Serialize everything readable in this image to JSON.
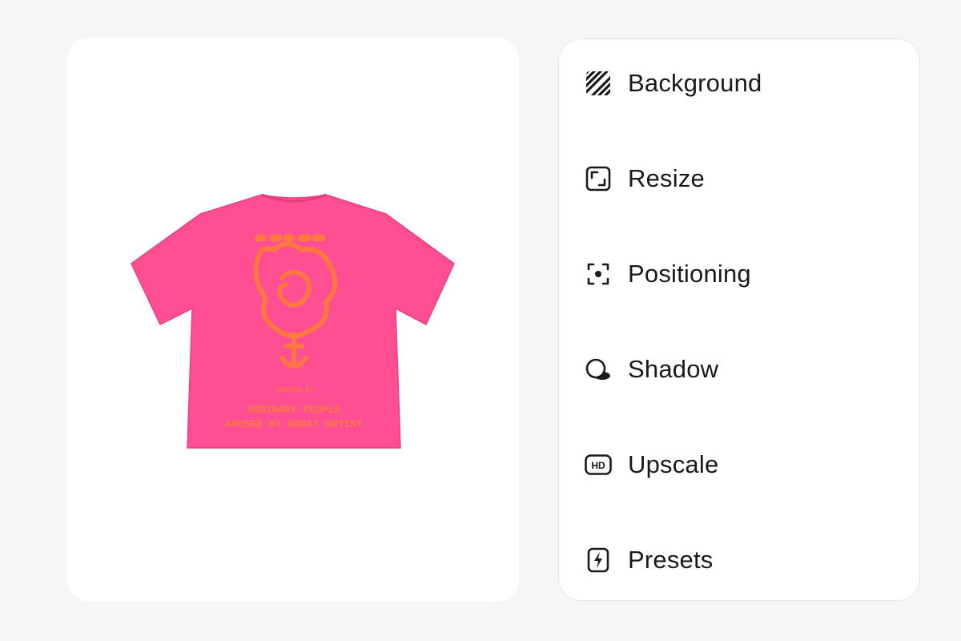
{
  "preview": {
    "image_alt": "Pink t-shirt product photo",
    "shirt_color": "#ff4f92",
    "print_color": "#ff7a3d",
    "print_lines": [
      "ORDINARY PEOPLE",
      "AMUSED BY GREAT ARTIST"
    ]
  },
  "tools": [
    {
      "label": "Background",
      "icon": "stripes-icon"
    },
    {
      "label": "Resize",
      "icon": "resize-icon"
    },
    {
      "label": "Positioning",
      "icon": "focus-icon"
    },
    {
      "label": "Shadow",
      "icon": "shadow-icon"
    },
    {
      "label": "Upscale",
      "icon": "hd-icon"
    },
    {
      "label": "Presets",
      "icon": "lightning-card-icon"
    }
  ]
}
